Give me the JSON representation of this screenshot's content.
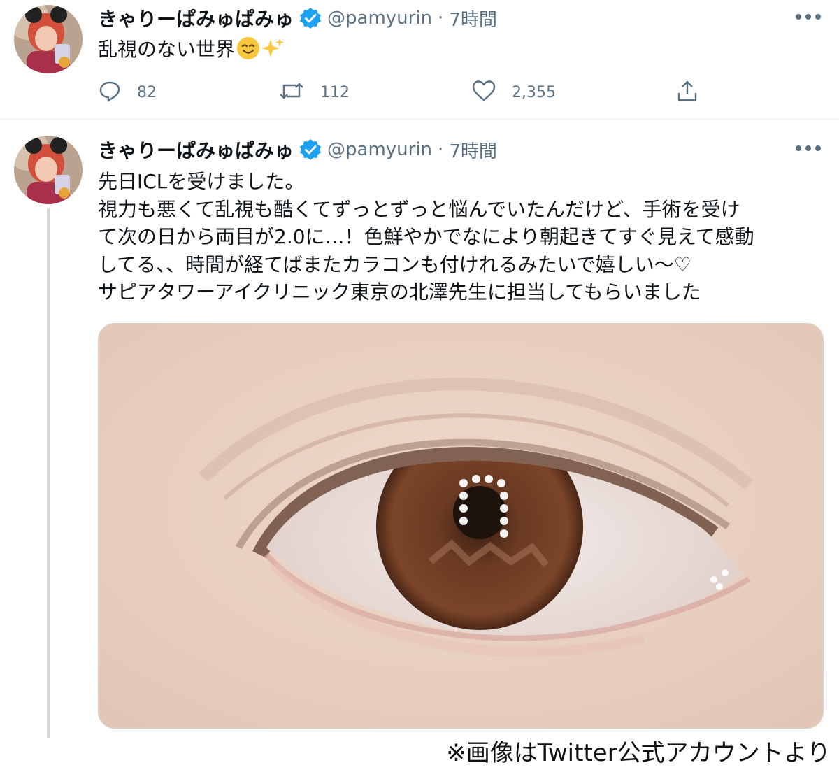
{
  "tweets": [
    {
      "display_name": "きゃりーぱみゅぱみゅ",
      "handle": "@pamyurin",
      "separator": "·",
      "time": "7時間",
      "text": "乱視のない世界",
      "emojis": [
        "smiling-face-icon",
        "sparkles-icon"
      ],
      "reply_count": "82",
      "retweet_count": "112",
      "like_count": "2,355"
    },
    {
      "display_name": "きゃりーぱみゅぱみゅ",
      "handle": "@pamyurin",
      "separator": "·",
      "time": "7時間",
      "text": "先日ICLを受けました。\n視力も悪くて乱視も酷くてずっとずっと悩んでいたんだけど、手術を受け\nて次の日から両目が2.0に…！色鮮やかでなにより朝起きてすぐ見えて感動\nしてる、、時間が経てばまたカラコンも付けれるみたいで嬉しい〜♡\nサピアタワーアイクリニック東京の北澤先生に担当してもらいました"
    }
  ],
  "credit": "※画像はTwitter公式アカウントより",
  "colors": {
    "text": "#0f1419",
    "secondary": "#5b7083",
    "verified": "#1da1f2",
    "divider": "#e6ecf0",
    "thread_line": "#cfd9de"
  }
}
